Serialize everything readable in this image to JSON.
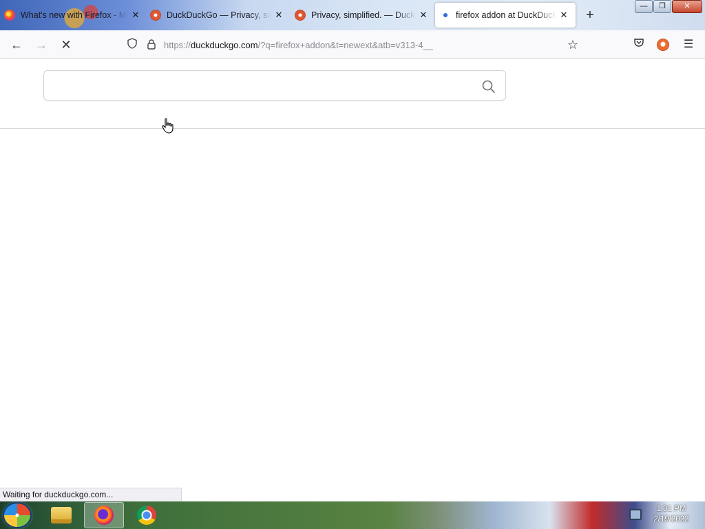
{
  "tabs": [
    {
      "title": "What's new with Firefox - Mo",
      "icon": "firefox-icon"
    },
    {
      "title": "DuckDuckGo — Privacy, simp",
      "icon": "duckduckgo-icon"
    },
    {
      "title": "Privacy, simplified. — DuckD",
      "icon": "duckduckgo-icon"
    },
    {
      "title": "firefox addon at DuckDuckGo",
      "icon": "loading-dot-icon",
      "active": true
    }
  ],
  "newtab_symbol": "+",
  "window_controls": {
    "minimize": "—",
    "restore": "❐",
    "close": "✕"
  },
  "nav": {
    "back_icon": "←",
    "forward_icon": "→",
    "stop_icon": "✕"
  },
  "url": {
    "prefix": "https://",
    "host": "duckduckgo.com",
    "path": "/?q=firefox+addon&t=newext&atb=v313-4__"
  },
  "search": {
    "value": "",
    "placeholder": ""
  },
  "status": "Waiting for duckduckgo.com...",
  "taskbar": {
    "items": [
      "windows-explorer",
      "firefox",
      "chrome"
    ],
    "time": "1:31 PM",
    "date": "2/19/2022"
  },
  "colors": {
    "accent": "#2d6cdf",
    "ddg_orange": "#de5833"
  }
}
